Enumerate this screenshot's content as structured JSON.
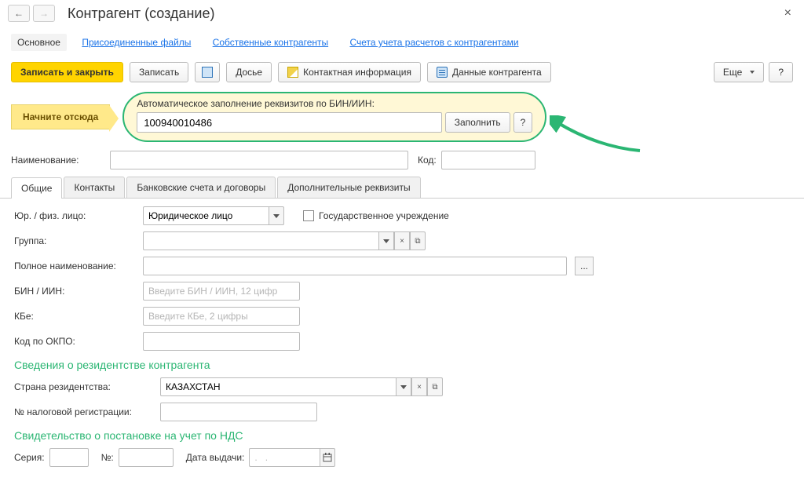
{
  "titlebar": {
    "back": "←",
    "forward": "→",
    "title": "Контрагент (создание)",
    "close": "×"
  },
  "linkbar": {
    "main": "Основное",
    "attached": "Присоединенные файлы",
    "own": "Собственные контрагенты",
    "accounts": "Счета учета расчетов с контрагентами"
  },
  "toolbar": {
    "save_close": "Записать и закрыть",
    "save": "Записать",
    "dossier": "Досье",
    "contact": "Контактная информация",
    "data": "Данные контрагента",
    "more": "Еще",
    "help": "?"
  },
  "startblock": {
    "hint": "Начните отсюда",
    "label": "Автоматическое заполнение реквизитов по БИН/ИИН:",
    "value": "100940010486",
    "fill": "Заполнить",
    "help": "?"
  },
  "namefield": {
    "label": "Наименование:",
    "code_label": "Код:"
  },
  "tabs": {
    "general": "Общие",
    "contacts": "Контакты",
    "bank": "Банковские счета и договоры",
    "extra": "Дополнительные реквизиты"
  },
  "form": {
    "legal_label": "Юр. / физ. лицо:",
    "legal_value": "Юридическое лицо",
    "gov_label": "Государственное учреждение",
    "group_label": "Группа:",
    "fullname_label": "Полное наименование:",
    "bin_label": "БИН / ИИН:",
    "bin_placeholder": "Введите БИН / ИИН, 12 цифр",
    "kbe_label": "КБе:",
    "kbe_placeholder": "Введите КБе, 2 цифры",
    "okpo_label": "Код по ОКПО:",
    "residency_section": "Сведения о резидентстве контрагента",
    "country_label": "Страна резидентства:",
    "country_value": "КАЗАХСТАН",
    "taxreg_label": "№ налоговой регистрации:",
    "nds_section": "Свидетельство о постановке на учет по НДС",
    "series_label": "Серия:",
    "number_label": "№:",
    "date_label": "Дата выдачи:",
    "date_placeholder": ".   .     "
  },
  "icons": {
    "cross": "×",
    "link": "⧉",
    "calendar": "📅"
  }
}
